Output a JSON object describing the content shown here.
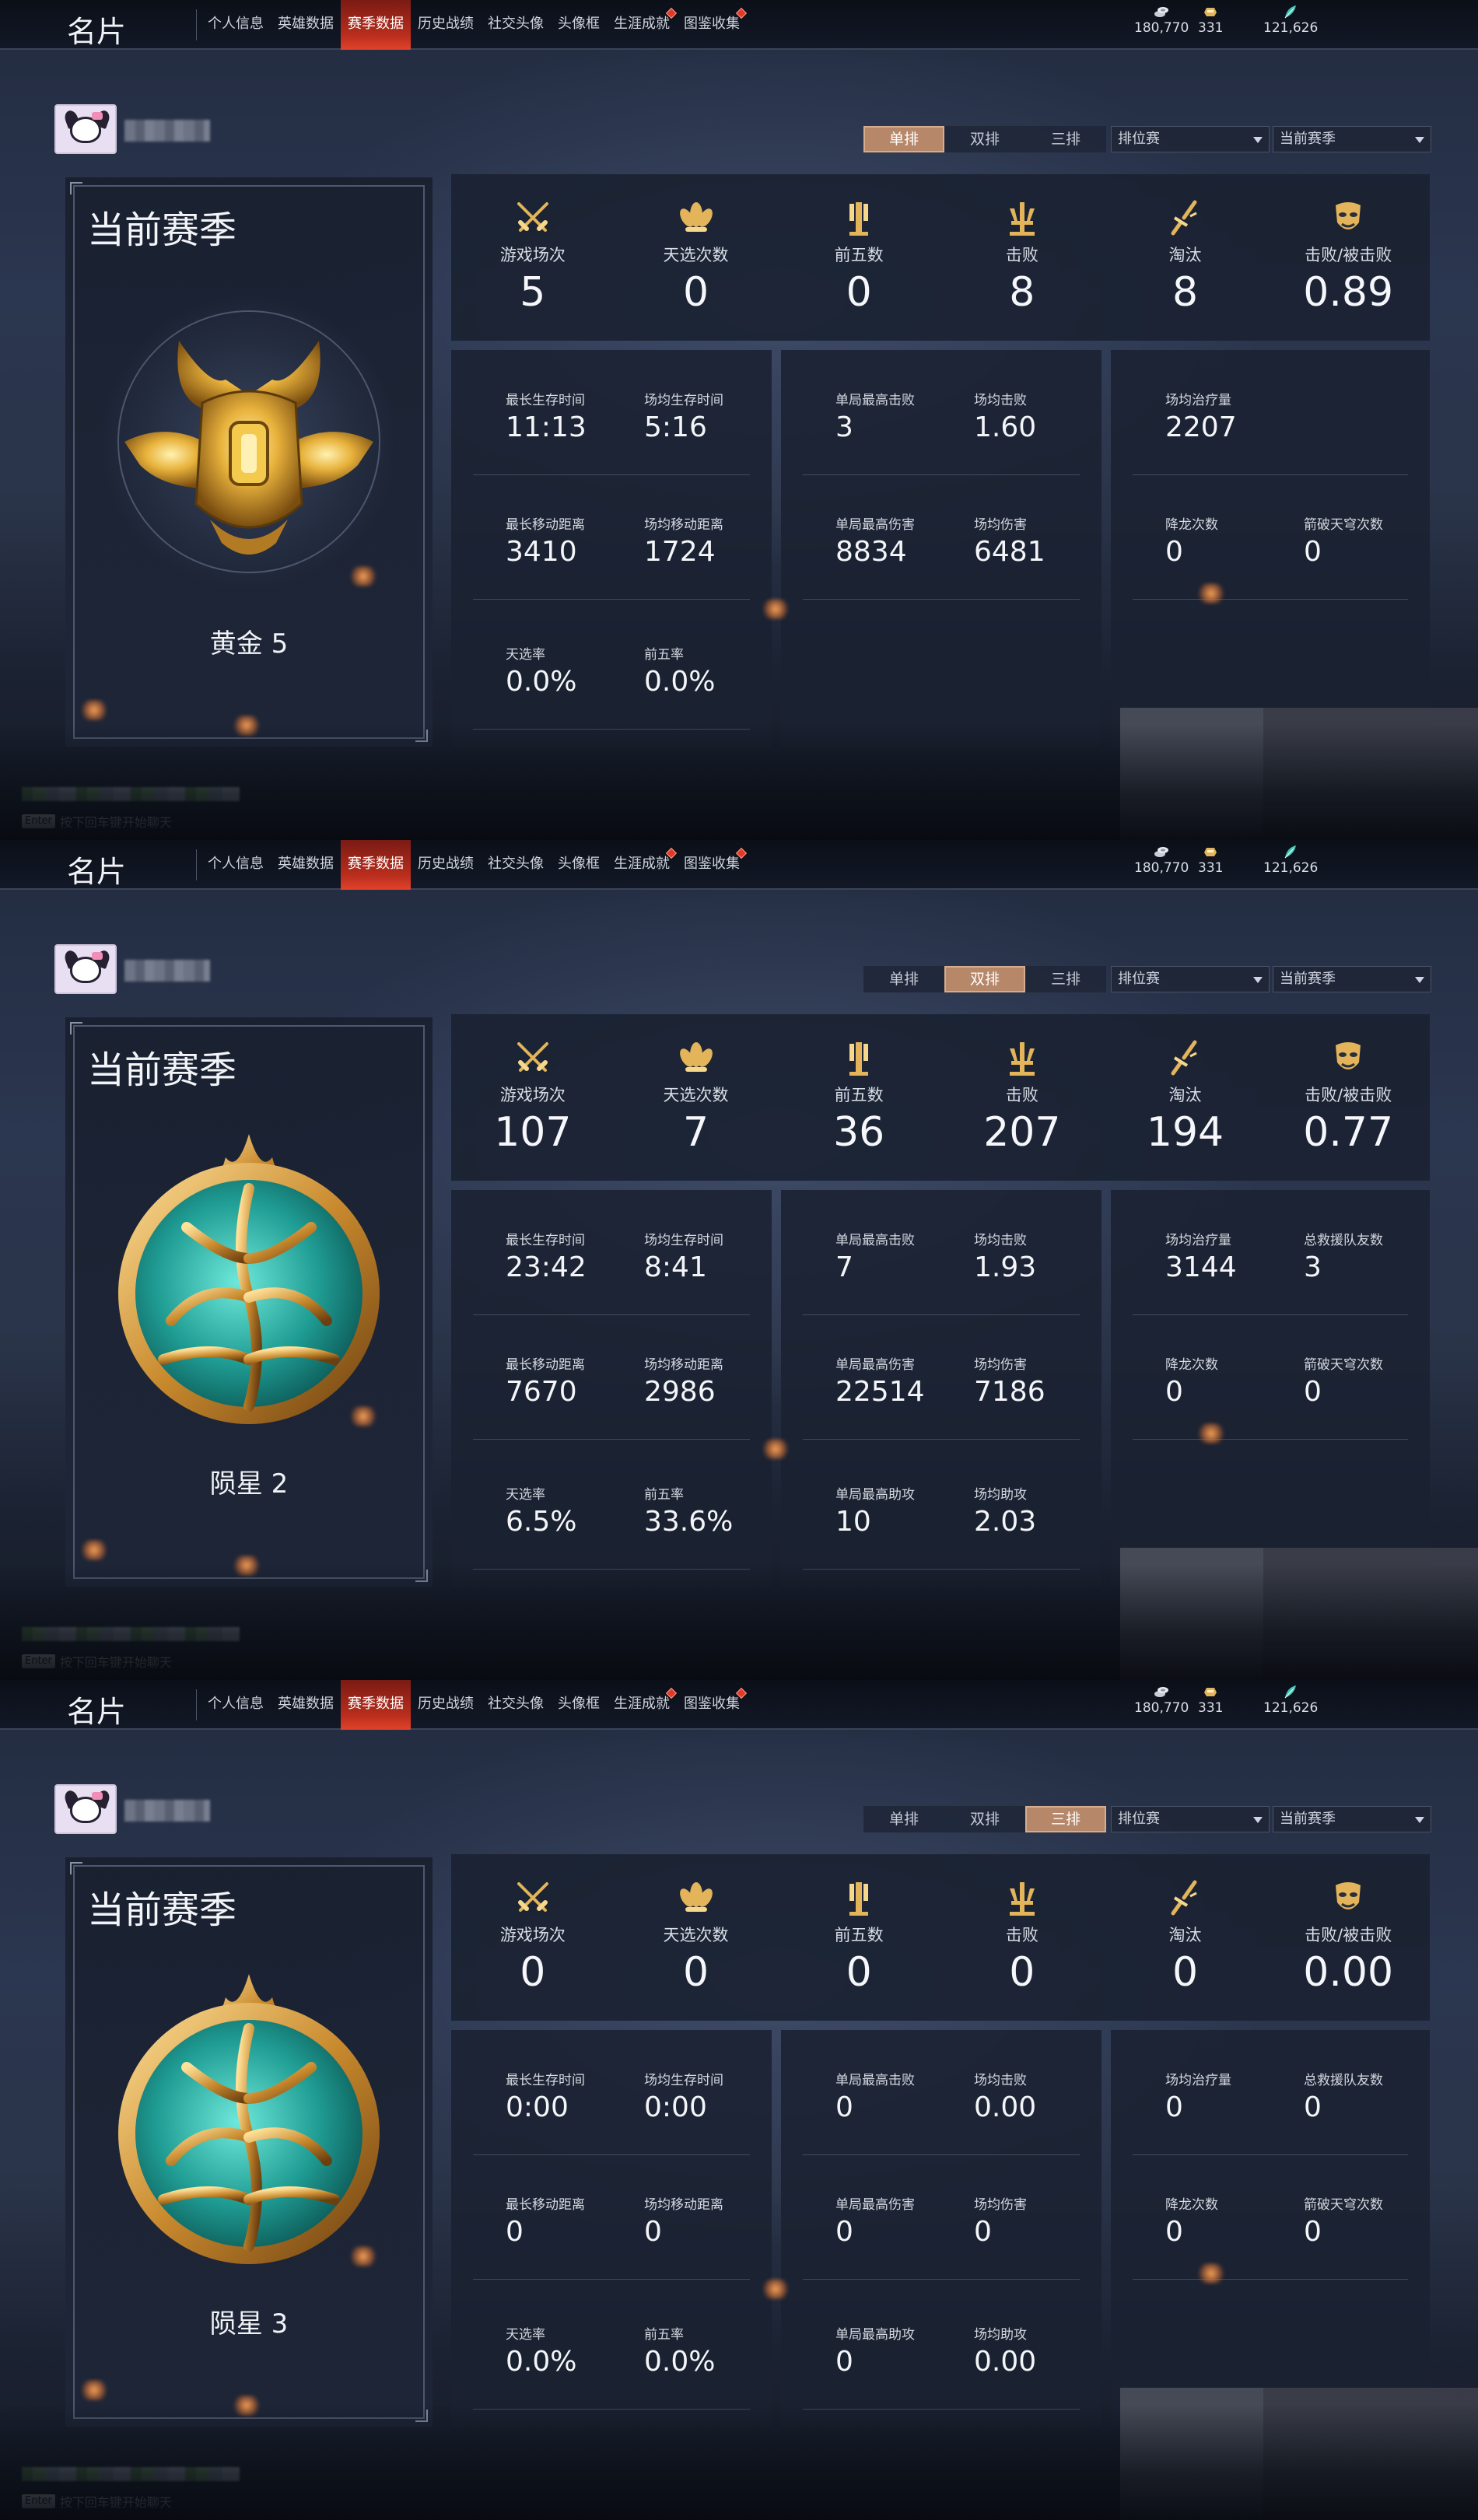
{
  "app": {
    "title": "名片",
    "tabs": [
      {
        "label": "个人信息",
        "dot": false
      },
      {
        "label": "英雄数据",
        "dot": false
      },
      {
        "label": "赛季数据",
        "dot": false
      },
      {
        "label": "历史战绩",
        "dot": false
      },
      {
        "label": "社交头像",
        "dot": false
      },
      {
        "label": "头像框",
        "dot": false
      },
      {
        "label": "生涯成就",
        "dot": true
      },
      {
        "label": "图鉴收集",
        "dot": true
      }
    ],
    "active_tab_index": 2,
    "currencies": [
      {
        "icon": "coin-stack-icon",
        "value": "180,770"
      },
      {
        "icon": "gold-ingot-icon",
        "value": "331"
      },
      {
        "icon": "jade-feather-icon",
        "value": "121,626"
      }
    ],
    "modes": [
      "单排",
      "双排",
      "三排"
    ],
    "chat_enter_key": "Enter",
    "chat_hint": "按下回车键开始聊天",
    "colors": {
      "accent_red": "#b92d1c",
      "segment_active": "#b7876a",
      "gold": "#e3b45a"
    }
  },
  "screens": [
    {
      "active_mode": 0,
      "queue_type": "排位赛",
      "season_filter": "当前赛季",
      "season_label": "当前赛季",
      "rank_name": "黄金 5",
      "rank_emblem": "gold-horned-emblem",
      "summary": [
        {
          "icon": "crossed-swords-icon",
          "label": "游戏场次",
          "value": "5"
        },
        {
          "icon": "lotus-icon",
          "label": "天选次数",
          "value": "0"
        },
        {
          "icon": "pillar-icon",
          "label": "前五数",
          "value": "0"
        },
        {
          "icon": "trident-icon",
          "label": "击败",
          "value": "8"
        },
        {
          "icon": "broken-sword-icon",
          "label": "淘汰",
          "value": "8"
        },
        {
          "icon": "mask-icon",
          "label": "击败/被击败",
          "value": "0.89"
        }
      ],
      "survival": [
        {
          "label": "最长生存时间",
          "value": "11:13"
        },
        {
          "label": "场均生存时间",
          "value": "5:16"
        },
        {
          "label": "最长移动距离",
          "value": "3410"
        },
        {
          "label": "场均移动距离",
          "value": "1724"
        },
        {
          "label": "天选率",
          "value": "0.0%"
        },
        {
          "label": "前五率",
          "value": "0.0%"
        }
      ],
      "combat": [
        {
          "label": "单局最高击败",
          "value": "3"
        },
        {
          "label": "场均击败",
          "value": "1.60"
        },
        {
          "label": "单局最高伤害",
          "value": "8834"
        },
        {
          "label": "场均伤害",
          "value": "6481"
        }
      ],
      "support": [
        {
          "label": "场均治疗量",
          "value": "2207"
        },
        {
          "label": "降龙次数",
          "value": "0"
        },
        {
          "label": "箭破天穹次数",
          "value": "0"
        }
      ]
    },
    {
      "active_mode": 1,
      "queue_type": "排位赛",
      "season_filter": "当前赛季",
      "season_label": "当前赛季",
      "rank_name": "陨星 2",
      "rank_emblem": "jade-orb-emblem",
      "summary": [
        {
          "icon": "crossed-swords-icon",
          "label": "游戏场次",
          "value": "107"
        },
        {
          "icon": "lotus-icon",
          "label": "天选次数",
          "value": "7"
        },
        {
          "icon": "pillar-icon",
          "label": "前五数",
          "value": "36"
        },
        {
          "icon": "trident-icon",
          "label": "击败",
          "value": "207"
        },
        {
          "icon": "broken-sword-icon",
          "label": "淘汰",
          "value": "194"
        },
        {
          "icon": "mask-icon",
          "label": "击败/被击败",
          "value": "0.77"
        }
      ],
      "survival": [
        {
          "label": "最长生存时间",
          "value": "23:42"
        },
        {
          "label": "场均生存时间",
          "value": "8:41"
        },
        {
          "label": "最长移动距离",
          "value": "7670"
        },
        {
          "label": "场均移动距离",
          "value": "2986"
        },
        {
          "label": "天选率",
          "value": "6.5%"
        },
        {
          "label": "前五率",
          "value": "33.6%"
        }
      ],
      "combat": [
        {
          "label": "单局最高击败",
          "value": "7"
        },
        {
          "label": "场均击败",
          "value": "1.93"
        },
        {
          "label": "单局最高伤害",
          "value": "22514"
        },
        {
          "label": "场均伤害",
          "value": "7186"
        },
        {
          "label": "单局最高助攻",
          "value": "10"
        },
        {
          "label": "场均助攻",
          "value": "2.03"
        }
      ],
      "support": [
        {
          "label": "场均治疗量",
          "value": "3144"
        },
        {
          "label": "总救援队友数",
          "value": "3"
        },
        {
          "label": "降龙次数",
          "value": "0"
        },
        {
          "label": "箭破天穹次数",
          "value": "0"
        }
      ]
    },
    {
      "active_mode": 2,
      "queue_type": "排位赛",
      "season_filter": "当前赛季",
      "season_label": "当前赛季",
      "rank_name": "陨星 3",
      "rank_emblem": "jade-orb-emblem",
      "summary": [
        {
          "icon": "crossed-swords-icon",
          "label": "游戏场次",
          "value": "0"
        },
        {
          "icon": "lotus-icon",
          "label": "天选次数",
          "value": "0"
        },
        {
          "icon": "pillar-icon",
          "label": "前五数",
          "value": "0"
        },
        {
          "icon": "trident-icon",
          "label": "击败",
          "value": "0"
        },
        {
          "icon": "broken-sword-icon",
          "label": "淘汰",
          "value": "0"
        },
        {
          "icon": "mask-icon",
          "label": "击败/被击败",
          "value": "0.00"
        }
      ],
      "survival": [
        {
          "label": "最长生存时间",
          "value": "0:00"
        },
        {
          "label": "场均生存时间",
          "value": "0:00"
        },
        {
          "label": "最长移动距离",
          "value": "0"
        },
        {
          "label": "场均移动距离",
          "value": "0"
        },
        {
          "label": "天选率",
          "value": "0.0%"
        },
        {
          "label": "前五率",
          "value": "0.0%"
        }
      ],
      "combat": [
        {
          "label": "单局最高击败",
          "value": "0"
        },
        {
          "label": "场均击败",
          "value": "0.00"
        },
        {
          "label": "单局最高伤害",
          "value": "0"
        },
        {
          "label": "场均伤害",
          "value": "0"
        },
        {
          "label": "单局最高助攻",
          "value": "0"
        },
        {
          "label": "场均助攻",
          "value": "0.00"
        }
      ],
      "support": [
        {
          "label": "场均治疗量",
          "value": "0"
        },
        {
          "label": "总救援队友数",
          "value": "0"
        },
        {
          "label": "降龙次数",
          "value": "0"
        },
        {
          "label": "箭破天穹次数",
          "value": "0"
        }
      ]
    }
  ]
}
